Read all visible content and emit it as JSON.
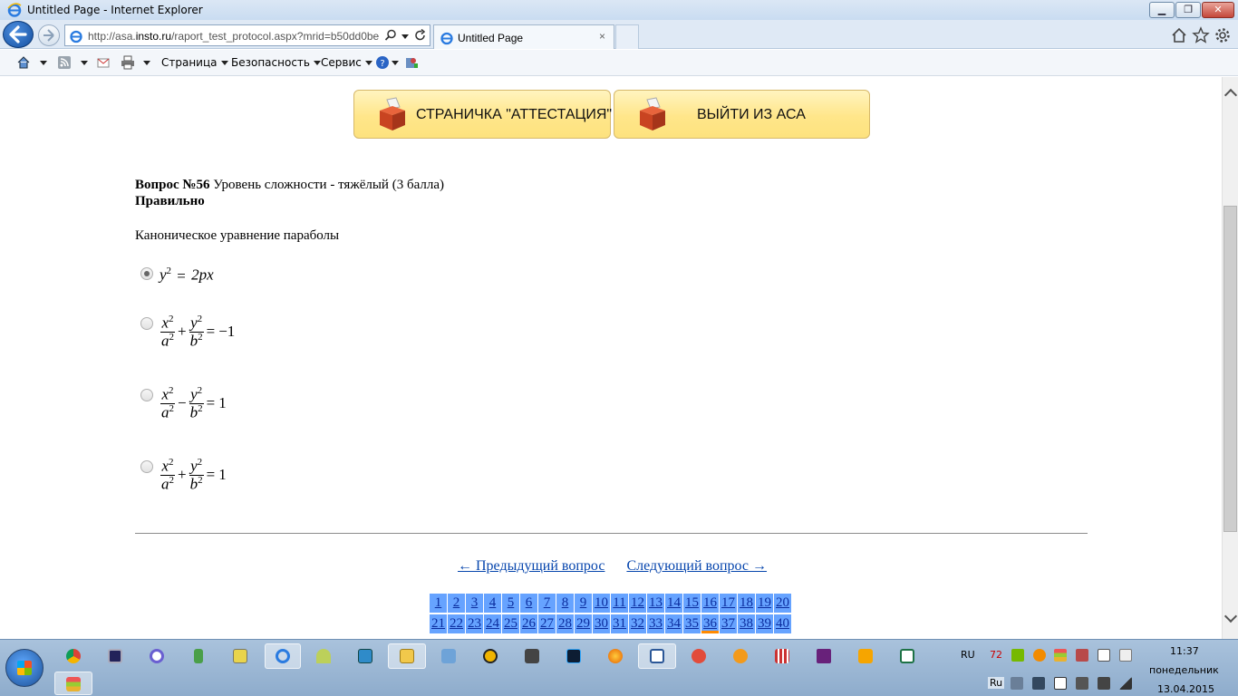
{
  "window": {
    "title": "Untitled Page - Internet Explorer"
  },
  "window_controls": {
    "minimize": "▁",
    "maximize": "❐",
    "close": "✕"
  },
  "address_bar": {
    "url_prefix": "http://asa.",
    "url_host": "insto.ru",
    "url_rest": "/raport_test_protocol.aspx?mrid=b50dd0be"
  },
  "tab": {
    "title": "Untitled Page",
    "close": "×"
  },
  "command_bar": {
    "menus": [
      "Страница",
      "Безопасность",
      "Сервис"
    ]
  },
  "buttons": {
    "attestation": "СТРАНИЧКА \"АТТЕСТАЦИЯ\"",
    "exit": "ВЫЙТИ ИЗ АСА"
  },
  "question": {
    "number_label": "Вопрос №56",
    "difficulty": "Уровень сложности - тяжёлый (3 балла)",
    "status": "Правильно",
    "text": "Каноническое уравнение параболы",
    "selected_index": 0
  },
  "formulas": {
    "f1": {
      "lhs": "y",
      "exp": "2",
      "eq": "=",
      "rhs": "2px"
    },
    "f2": {
      "n1": "x",
      "d1": "a",
      "op": "+",
      "n2": "y",
      "d2": "b",
      "eq": "=",
      "rhs": "−1"
    },
    "f3": {
      "n1": "x",
      "d1": "a",
      "op": "−",
      "n2": "y",
      "d2": "b",
      "eq": "=",
      "rhs": "1"
    },
    "f4": {
      "n1": "x",
      "d1": "a",
      "op": "+",
      "n2": "y",
      "d2": "b",
      "eq": "=",
      "rhs": "1"
    },
    "sq": "2"
  },
  "navigation": {
    "prev": "← Предыдущий вопрос",
    "next": "Следующий вопрос →"
  },
  "question_grid": {
    "row1": [
      "1",
      "2",
      "3",
      "4",
      "5",
      "6",
      "7",
      "8",
      "9",
      "10",
      "11",
      "12",
      "13",
      "14",
      "15",
      "16",
      "17",
      "18",
      "19",
      "20"
    ],
    "row2": [
      "21",
      "22",
      "23",
      "24",
      "25",
      "26",
      "27",
      "28",
      "29",
      "30",
      "31",
      "32",
      "33",
      "34",
      "35",
      "36",
      "37",
      "38",
      "39",
      "40"
    ],
    "current": "36"
  },
  "tray": {
    "lang_top": "RU",
    "temp_badge": "72",
    "lang_bottom": "Ru",
    "time": "11:37",
    "weekday": "понедельник",
    "date": "13.04.2015"
  },
  "colors": {
    "accent_blue": "#66a3ff",
    "button_yellow": "#ffe68a",
    "current_marker": "#ff8a00"
  }
}
